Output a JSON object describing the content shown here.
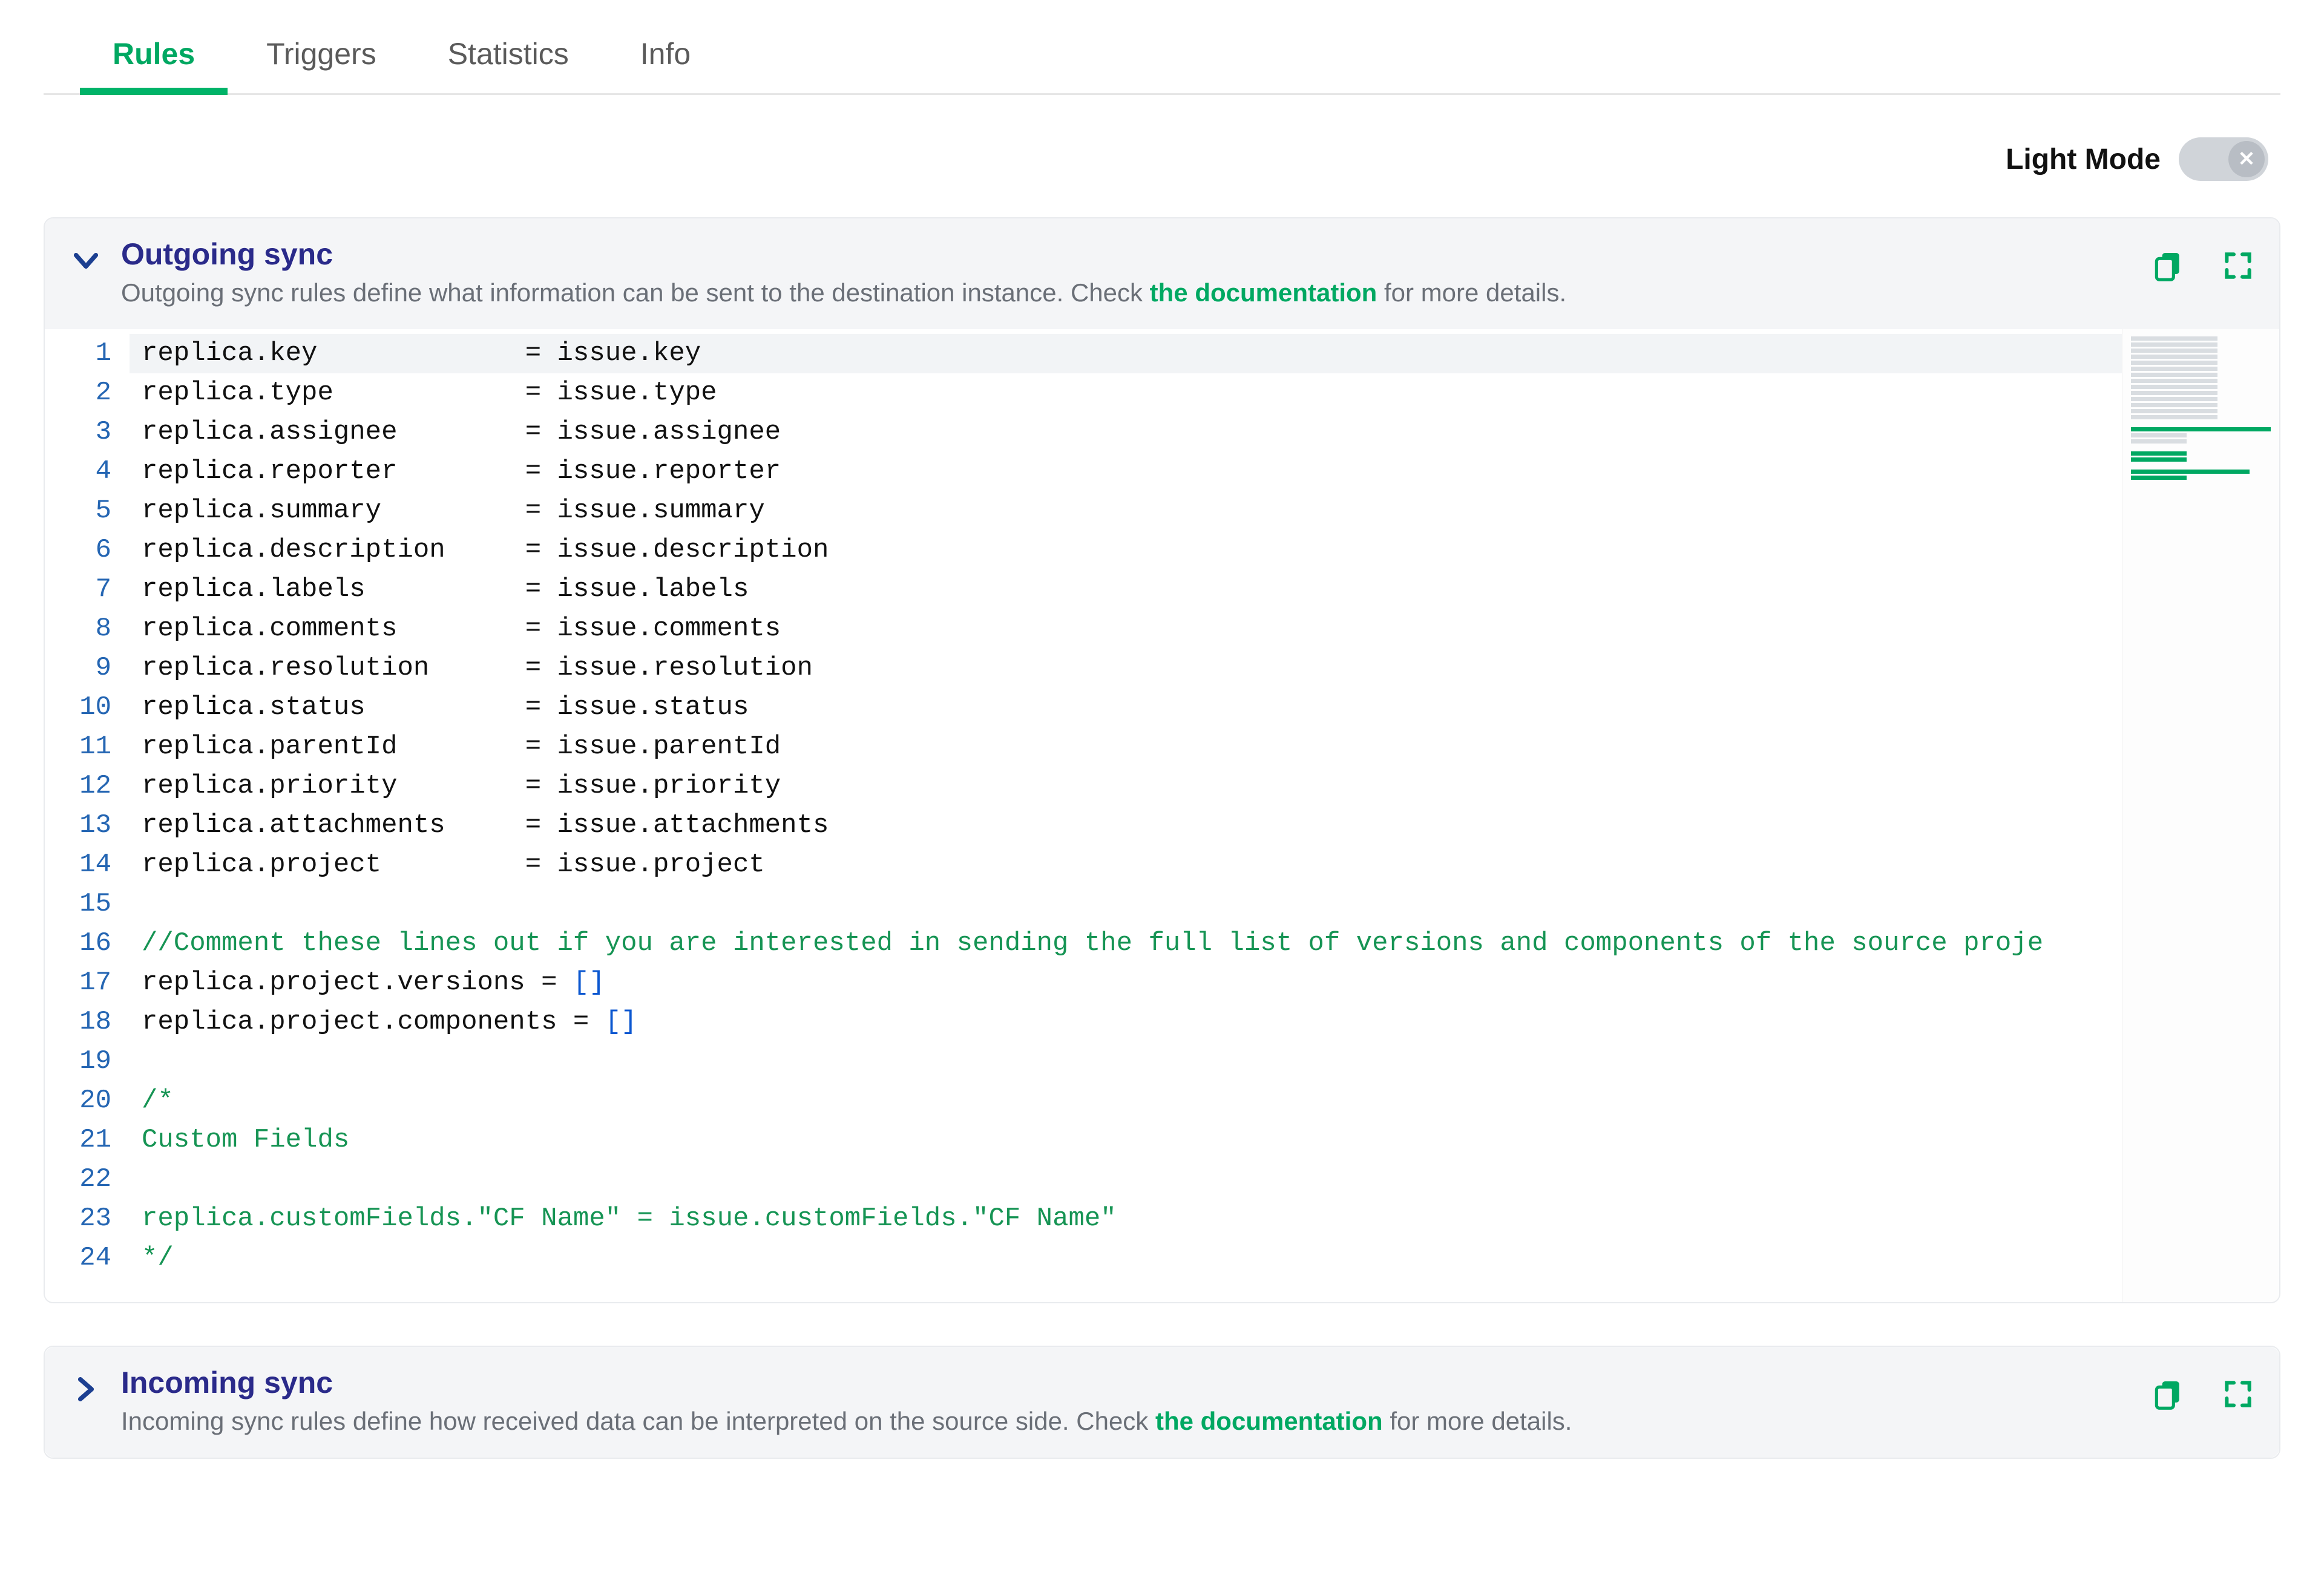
{
  "tabs": {
    "rules": "Rules",
    "triggers": "Triggers",
    "statistics": "Statistics",
    "info": "Info"
  },
  "mode_toggle": {
    "label": "Light Mode",
    "knob_glyph": "✕"
  },
  "outgoing": {
    "title": "Outgoing sync",
    "desc_before": "Outgoing sync rules define what information can be sent to the destination instance. Check ",
    "doc_link": "the documentation",
    "desc_after": " for more details."
  },
  "incoming": {
    "title": "Incoming sync",
    "desc_before": "Incoming sync rules define how received data can be interpreted on the source side. Check ",
    "doc_link": "the documentation",
    "desc_after": " for more details."
  },
  "code": {
    "line_count": 24,
    "assignments": [
      {
        "left": "replica.key",
        "right": "issue.key"
      },
      {
        "left": "replica.type",
        "right": "issue.type"
      },
      {
        "left": "replica.assignee",
        "right": "issue.assignee"
      },
      {
        "left": "replica.reporter",
        "right": "issue.reporter"
      },
      {
        "left": "replica.summary",
        "right": "issue.summary"
      },
      {
        "left": "replica.description",
        "right": "issue.description"
      },
      {
        "left": "replica.labels",
        "right": "issue.labels"
      },
      {
        "left": "replica.comments",
        "right": "issue.comments"
      },
      {
        "left": "replica.resolution",
        "right": "issue.resolution"
      },
      {
        "left": "replica.status",
        "right": "issue.status"
      },
      {
        "left": "replica.parentId",
        "right": "issue.parentId"
      },
      {
        "left": "replica.priority",
        "right": "issue.priority"
      },
      {
        "left": "replica.attachments",
        "right": "issue.attachments"
      },
      {
        "left": "replica.project",
        "right": "issue.project"
      }
    ],
    "comment16": "//Comment these lines out if you are interested in sending the full list of versions and components of the source proje",
    "line17_left": "replica.project.versions",
    "line18_left": "replica.project.components",
    "brackets": "[]",
    "line20": "/*",
    "line21": "Custom Fields",
    "line23_left": "replica.customFields.",
    "line23_str": "\"CF Name\"",
    "line23_mid": " = issue.customFields.",
    "line24": "*/"
  }
}
